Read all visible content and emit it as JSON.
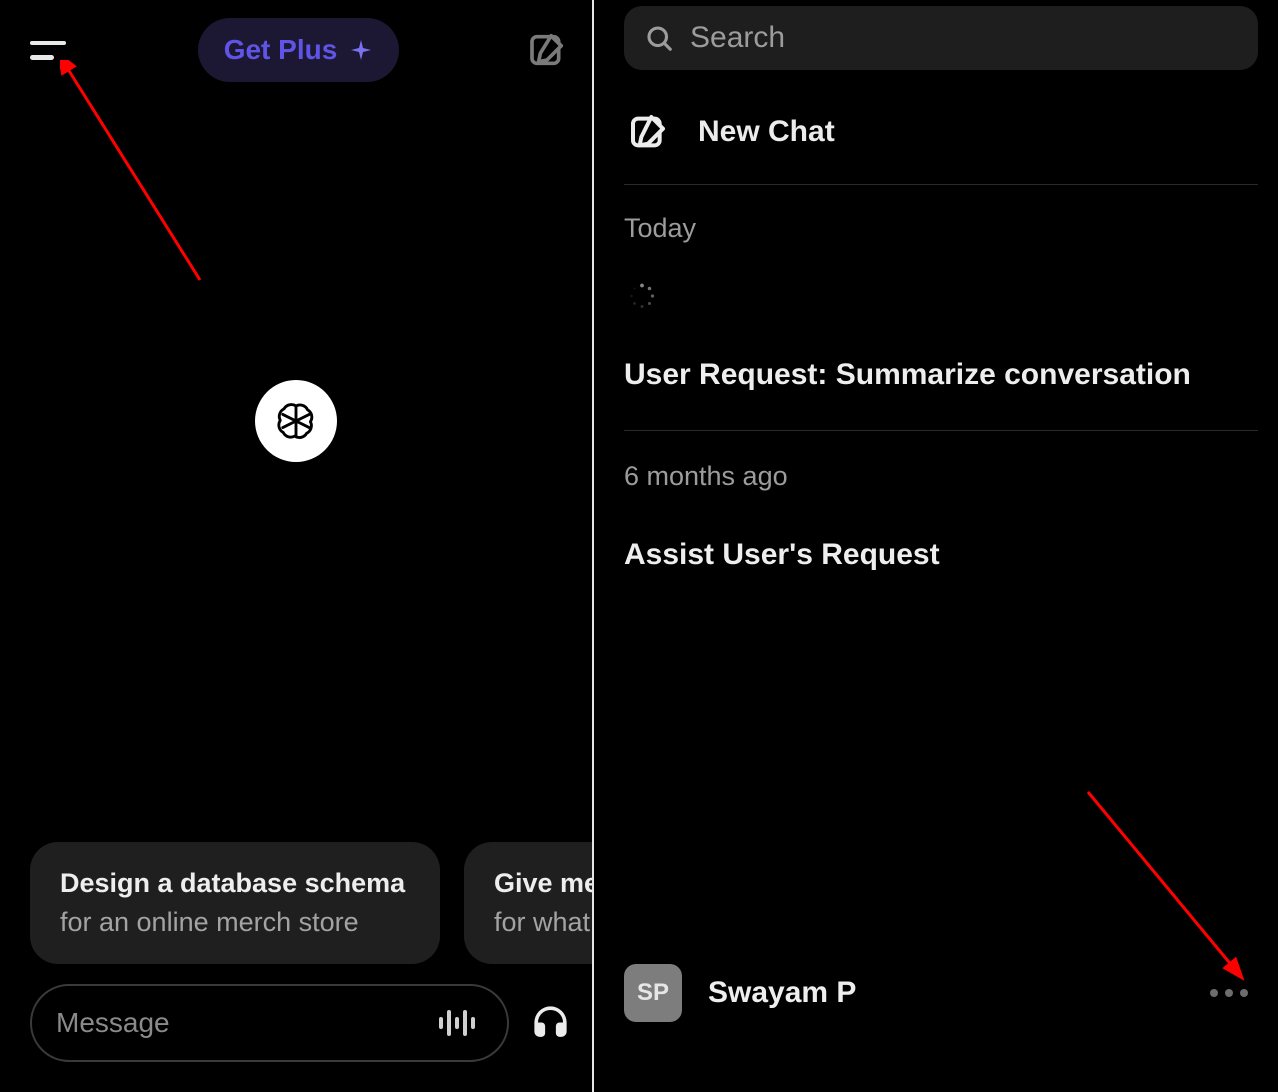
{
  "left": {
    "header": {
      "plus_label": "Get Plus"
    },
    "suggestions": [
      {
        "title": "Design a database schema",
        "subtitle": "for an online merch store"
      },
      {
        "title": "Give me",
        "subtitle": "for what"
      }
    ],
    "composer": {
      "placeholder": "Message"
    }
  },
  "right": {
    "search": {
      "placeholder": "Search"
    },
    "new_chat_label": "New Chat",
    "sections": [
      {
        "label": "Today",
        "items": [
          {
            "loading": true
          },
          {
            "title": "User Request: Summarize conversation"
          }
        ]
      },
      {
        "label": "6 months ago",
        "items": [
          {
            "title": "Assist User's Request"
          }
        ]
      }
    ],
    "profile": {
      "initials": "SP",
      "name": "Swayam P"
    }
  }
}
